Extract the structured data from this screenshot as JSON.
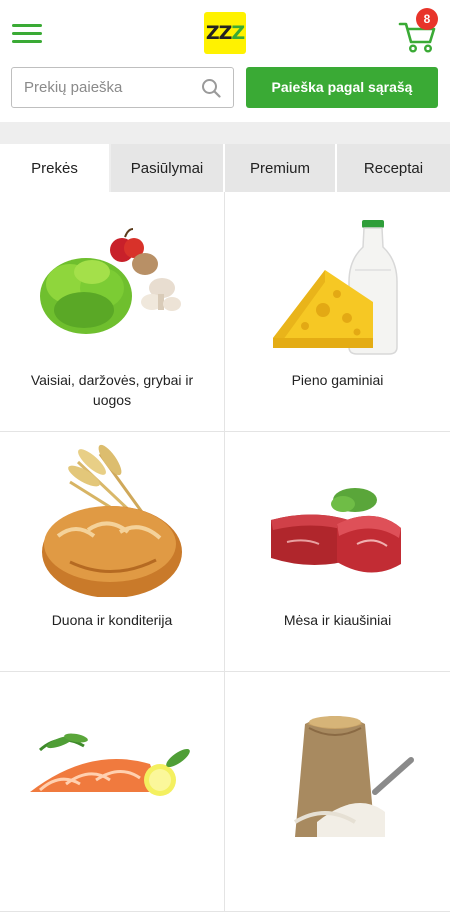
{
  "header": {
    "logo_text_1": "ZZ",
    "logo_text_2": "Z",
    "cart_count": "8"
  },
  "search": {
    "placeholder": "Prekių paieška",
    "list_button_label": "Paieška pagal sąrašą"
  },
  "tabs": [
    {
      "label": "Prekės",
      "active": true
    },
    {
      "label": "Pasiūlymai",
      "active": false
    },
    {
      "label": "Premium",
      "active": false
    },
    {
      "label": "Receptai",
      "active": false
    }
  ],
  "categories": [
    {
      "label": "Vaisiai, daržovės, grybai ir uogos",
      "icon": "vegetables-image"
    },
    {
      "label": "Pieno gaminiai",
      "icon": "dairy-image"
    },
    {
      "label": "Duona ir konditerija",
      "icon": "bread-image"
    },
    {
      "label": "Mėsa ir kiaušiniai",
      "icon": "meat-image"
    },
    {
      "label": "",
      "icon": "fish-image"
    },
    {
      "label": "",
      "icon": "flour-grains-image"
    }
  ],
  "colors": {
    "accent": "#3aaa35",
    "logo_bg": "#fff200",
    "badge": "#e8342a"
  }
}
